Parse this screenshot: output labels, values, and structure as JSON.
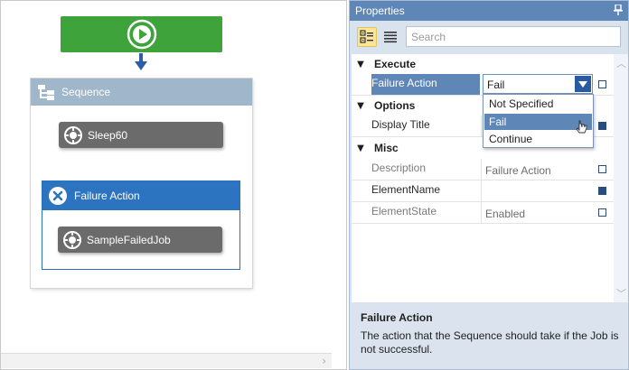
{
  "canvas": {
    "sequence": {
      "title": "Sequence"
    },
    "activities": {
      "sleep": "Sleep60",
      "failed_job": "SampleFailedJob"
    },
    "failure_block": {
      "title": "Failure Action"
    }
  },
  "properties": {
    "panel_title": "Properties",
    "search_placeholder": "Search",
    "categories": {
      "execute": "Execute",
      "options": "Options",
      "misc": "Misc"
    },
    "rows": {
      "failure_action": {
        "name": "Failure Action",
        "value": "Fail"
      },
      "display_title": {
        "name": "Display Title",
        "value": ""
      },
      "description": {
        "name": "Description",
        "value": "Failure Action"
      },
      "element_name": {
        "name": "ElementName",
        "value": ""
      },
      "element_state": {
        "name": "ElementState",
        "value": "Enabled"
      }
    },
    "dropdown_options": [
      "Not Specified",
      "Fail",
      "Continue"
    ],
    "description_panel": {
      "title": "Failure Action",
      "text": "The action that the Sequence should take if the Job is not successful."
    }
  },
  "icons": {
    "start": "play-circle-icon",
    "sequence": "sequence-tree-icon",
    "activity": "activity-gear-icon",
    "failure": "failure-x-icon",
    "categorized": "categorized-view-icon",
    "alphabetical": "alphabetical-list-icon",
    "pin": "pin-icon"
  },
  "colors": {
    "start_green": "#3da33a",
    "sequence_header": "#9fb6cb",
    "failure_blue": "#2d74c0",
    "activity_gray": "#6b6b6b",
    "selection_blue": "#5e87b8"
  }
}
